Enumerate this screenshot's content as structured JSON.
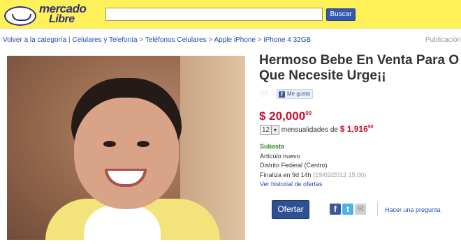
{
  "header": {
    "logo_line1": "mercado",
    "logo_line2": "Libre",
    "search": {
      "value": "",
      "placeholder": ""
    },
    "search_button": "Buscar",
    "colors": {
      "header_bg": "#fff159",
      "brand_blue": "#2d3277",
      "button_blue": "#3258b1"
    }
  },
  "breadcrumb": {
    "items": [
      "Volver a la categoría",
      "Celulares y Telefonía",
      "Teléfonos Celulares",
      "Apple iPhone",
      "iPhone 4 32GB"
    ],
    "separators": [
      "|",
      ">",
      ">",
      ">"
    ]
  },
  "publication_label": "Publicación",
  "listing": {
    "title_line1": "Hermoso Bebe En Venta Para O",
    "title_line2": "Que Necesite Urge¡¡",
    "like_label": "Me gusta",
    "price_main": "$ 20,000",
    "price_cents": "00",
    "installments_count": "12",
    "installments_label": "mensualidades de",
    "installment_main": "$ 1,916",
    "installment_cents": "50",
    "sale_type": "Subasta",
    "condition": "Artículo nuevo",
    "location": "Distrito Federal (Centro)",
    "ends_label": "Finaliza en 9d 14h",
    "ends_date": "(19/02/2012 15:00)",
    "history_link": "Ver historial de ofertas",
    "bid_button": "Ofertar",
    "ask_link": "Hacer una pregunta",
    "price_color": "#c8102e",
    "link_color": "#1d4bbb"
  },
  "icons": [
    "heart-icon",
    "facebook-icon",
    "twitter-icon",
    "mail-icon"
  ]
}
